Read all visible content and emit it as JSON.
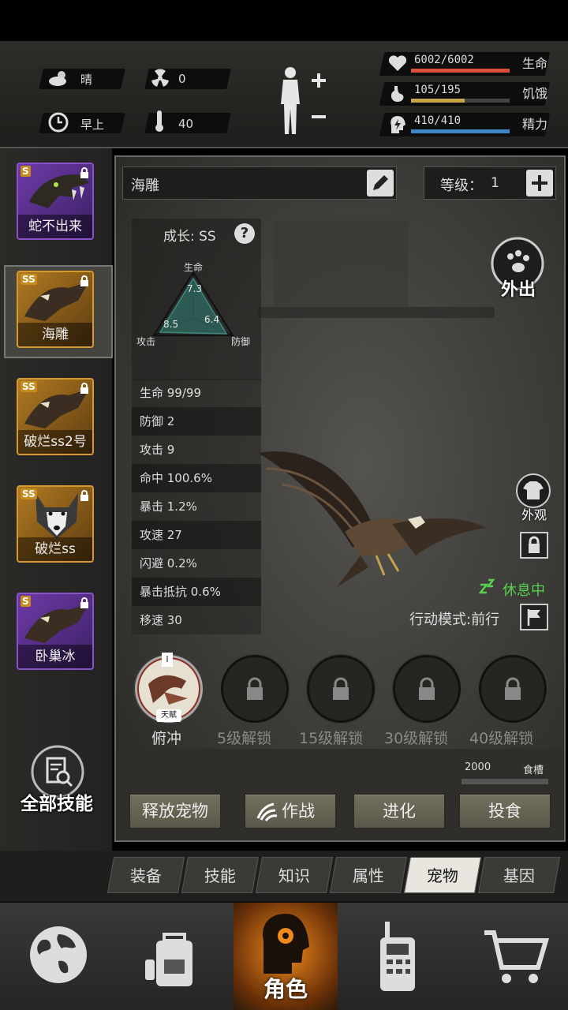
{
  "header": {
    "weather": {
      "icon": "cloud-sun-icon",
      "label": "晴"
    },
    "radiation": {
      "icon": "radiation-icon",
      "value": "0"
    },
    "time": {
      "icon": "clock-icon",
      "label": "早上"
    },
    "temperature": {
      "icon": "thermometer-icon",
      "value": "40"
    },
    "health": {
      "value": "6002/6002",
      "label": "生命",
      "fraction": 1.0,
      "color": "#d9503f"
    },
    "hunger": {
      "value": "105/195",
      "label": "饥饿",
      "fraction": 0.54,
      "color": "#c9a64a"
    },
    "energy": {
      "value": "410/410",
      "label": "精力",
      "fraction": 1.0,
      "color": "#3f86c9"
    }
  },
  "pets": [
    {
      "name": "蛇不出来",
      "grade": "S",
      "frame": "purple"
    },
    {
      "name": "海雕",
      "grade": "SS",
      "frame": "gold",
      "selected": true
    },
    {
      "name": "破烂ss2号",
      "grade": "SS",
      "frame": "gold"
    },
    {
      "name": "破烂ss",
      "grade": "SS",
      "frame": "gold"
    },
    {
      "name": "卧巢冰",
      "grade": "S",
      "frame": "purple"
    }
  ],
  "all_skills_label": "全部技能",
  "detail": {
    "name": "海雕",
    "level_label": "等级：",
    "level_value": "1",
    "growth": "成长: SS",
    "radar": {
      "top_label": "生命",
      "left_label": "攻击",
      "right_label": "防御",
      "life": "7.3",
      "attack": "8.5",
      "defense": "6.4"
    },
    "stats": [
      "生命 99/99",
      "防御 2",
      "攻击 9",
      "命中 100.6%",
      "暴击 1.2%",
      "攻速 27",
      "闪避 0.2%",
      "暴击抵抗 0.6%",
      "移速 30"
    ],
    "go_out": "外出",
    "appearance": "外观",
    "status": "休息中",
    "action_mode": "行动模式:前行"
  },
  "skills": [
    {
      "label": "俯冲",
      "badge": "天赋",
      "locked": false
    },
    {
      "label": "5级解锁",
      "locked": true
    },
    {
      "label": "15级解锁",
      "locked": true
    },
    {
      "label": "30级解锁",
      "locked": true
    },
    {
      "label": "40级解锁",
      "locked": true
    }
  ],
  "food": {
    "value": "2000",
    "label": "食槽"
  },
  "actions": [
    "释放宠物",
    "作战",
    "进化",
    "投食"
  ],
  "tabs": [
    "装备",
    "技能",
    "知识",
    "属性",
    "宠物",
    "基因"
  ],
  "active_tab": "宠物",
  "nav": {
    "active_label": "角色"
  }
}
